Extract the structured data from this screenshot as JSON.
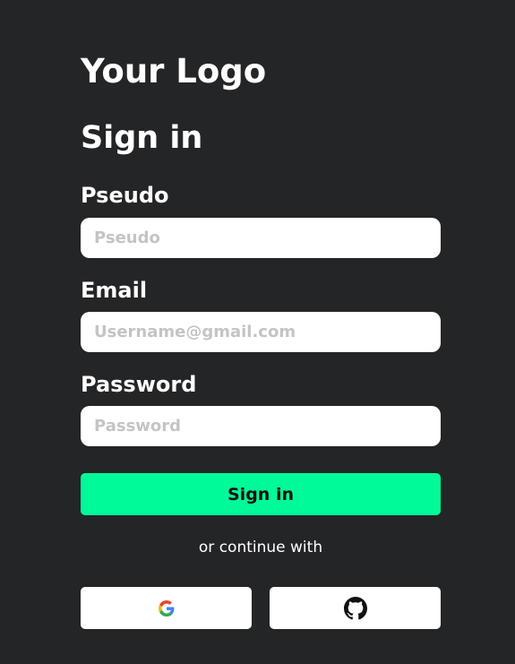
{
  "brand": {
    "logo_text": "Your Logo"
  },
  "form": {
    "title": "Sign in",
    "fields": [
      {
        "label": "Pseudo",
        "placeholder": "Pseudo",
        "value": ""
      },
      {
        "label": "Email",
        "placeholder": "Username@gmail.com",
        "value": ""
      },
      {
        "label": "Password",
        "placeholder": "Password",
        "value": ""
      }
    ],
    "submit_label": "Sign in"
  },
  "social": {
    "divider_text": "or continue with",
    "providers": [
      {
        "name": "Google",
        "icon": "google-icon"
      },
      {
        "name": "GitHub",
        "icon": "github-icon"
      }
    ]
  },
  "colors": {
    "background": "#242527",
    "accent": "#00fa9a",
    "input_background": "#ffffff",
    "placeholder": "#c4c4c4",
    "text": "#ffffff"
  }
}
